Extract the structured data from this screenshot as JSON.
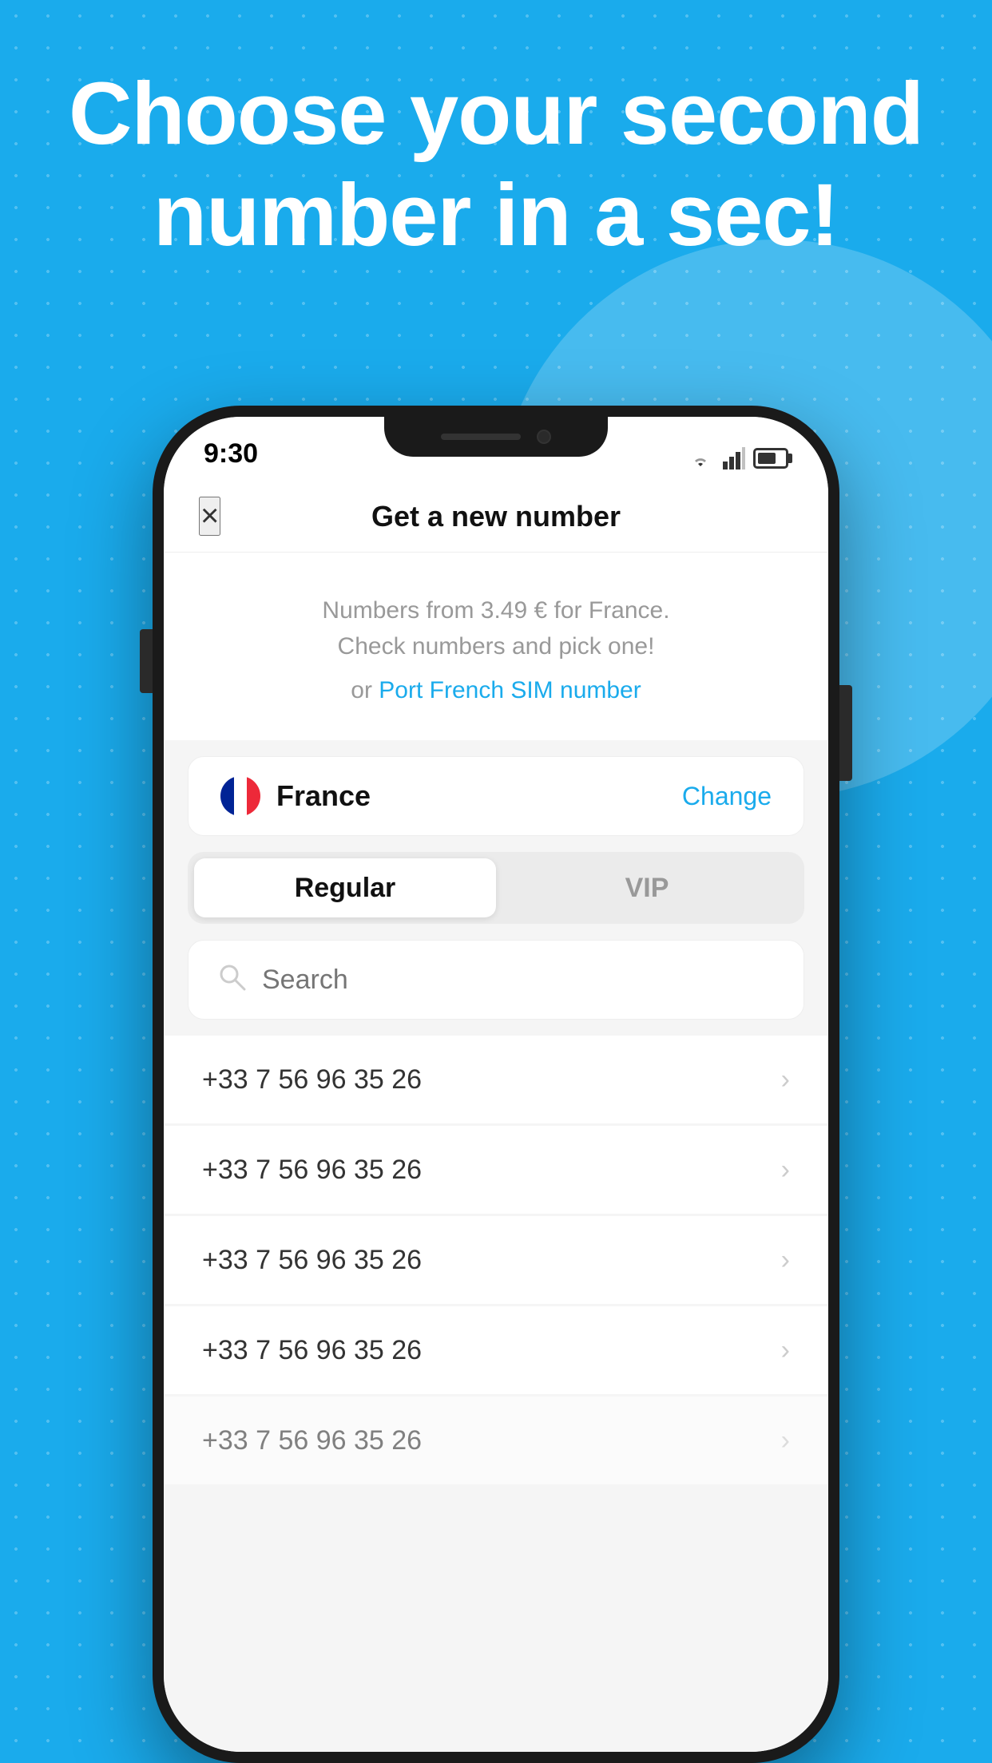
{
  "background": {
    "color": "#1AABEC"
  },
  "hero": {
    "line1": "Choose your second",
    "line2": "number in a sec!"
  },
  "status_bar": {
    "time": "9:30"
  },
  "header": {
    "title": "Get a new number",
    "close_label": "×"
  },
  "info": {
    "description": "Numbers from 3.49 € for France.\nCheck numbers and pick one!",
    "port_link_prefix": "or ",
    "port_link_text": "Port French SIM number"
  },
  "country": {
    "name": "France",
    "change_label": "Change"
  },
  "tabs": [
    {
      "id": "regular",
      "label": "Regular",
      "active": true
    },
    {
      "id": "vip",
      "label": "VIP",
      "active": false
    }
  ],
  "search": {
    "placeholder": "Search"
  },
  "numbers": [
    {
      "value": "+33 7 56 96 35 26"
    },
    {
      "value": "+33 7 56 96 35 26"
    },
    {
      "value": "+33 7 56 96 35 26"
    },
    {
      "value": "+33 7 56 96 35 26"
    },
    {
      "value": "+33 7 56 96 35 26"
    }
  ]
}
